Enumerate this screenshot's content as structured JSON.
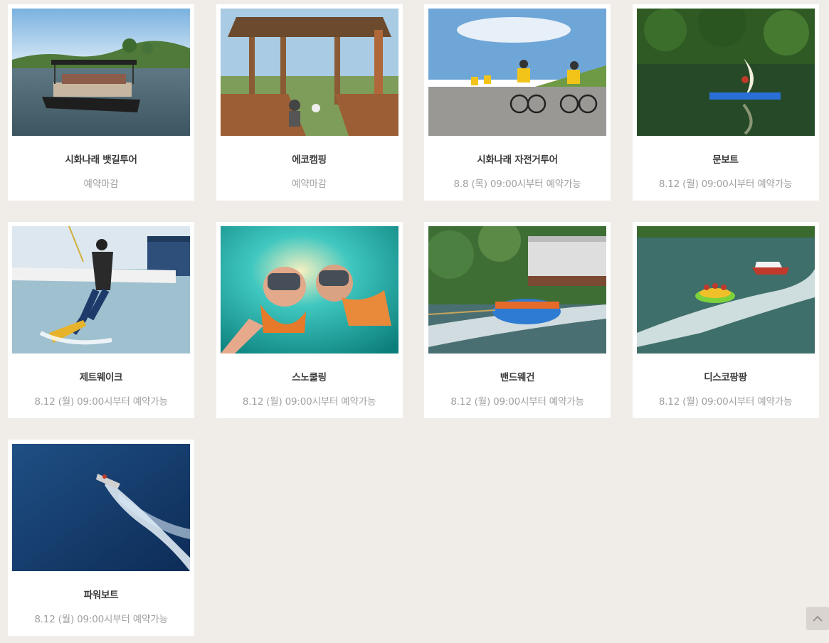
{
  "programs": [
    {
      "title": "시화나래 뱃길투어",
      "status": "예약마감",
      "image": "boat-tour-photo"
    },
    {
      "title": "에코캠핑",
      "status": "예약마감",
      "image": "eco-camping-pavilion-photo"
    },
    {
      "title": "시화나래 자전거투어",
      "status": "8.8 (목) 09:00시부터 예약가능",
      "image": "bicycle-tour-photo"
    },
    {
      "title": "문보트",
      "status": "8.12 (월) 09:00시부터 예약가능",
      "image": "moon-boat-photo"
    },
    {
      "title": "제트웨이크",
      "status": "8.12 (월) 09:00시부터 예약가능",
      "image": "jet-wake-photo"
    },
    {
      "title": "스노쿨링",
      "status": "8.12 (월) 09:00시부터 예약가능",
      "image": "snorkeling-photo"
    },
    {
      "title": "밴드웨건",
      "status": "8.12 (월) 09:00시부터 예약가능",
      "image": "band-wagon-photo"
    },
    {
      "title": "디스코팡팡",
      "status": "8.12 (월) 09:00시부터 예약가능",
      "image": "disco-pangpang-photo"
    },
    {
      "title": "파워보트",
      "status": "8.12 (월) 09:00시부터 예약가능",
      "image": "power-boat-photo"
    }
  ],
  "colors": {
    "background": "#f0ece8",
    "card": "#ffffff",
    "title": "#3a3a3a",
    "status": "#a0a0a0"
  },
  "scroll_top_icon": "chevron-up-icon"
}
